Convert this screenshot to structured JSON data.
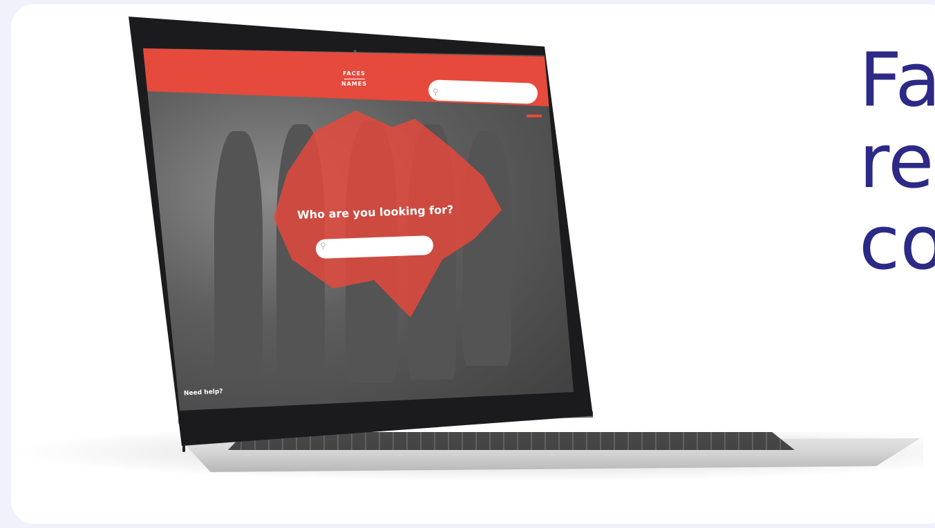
{
  "slide": {
    "headline_lines": [
      "Fa",
      "re",
      "co"
    ],
    "text_color": "#2c2a86",
    "card_color": "#ffffff",
    "page_color": "#f1f1fb"
  },
  "website": {
    "logo_line1": "FACES",
    "logo_line2": "NAMES",
    "header_color": "#e64a3c",
    "hero_title": "Who are you looking for?",
    "help_link": "Need help?",
    "search_icon": "magnifier-icon",
    "map": "canada-map"
  }
}
